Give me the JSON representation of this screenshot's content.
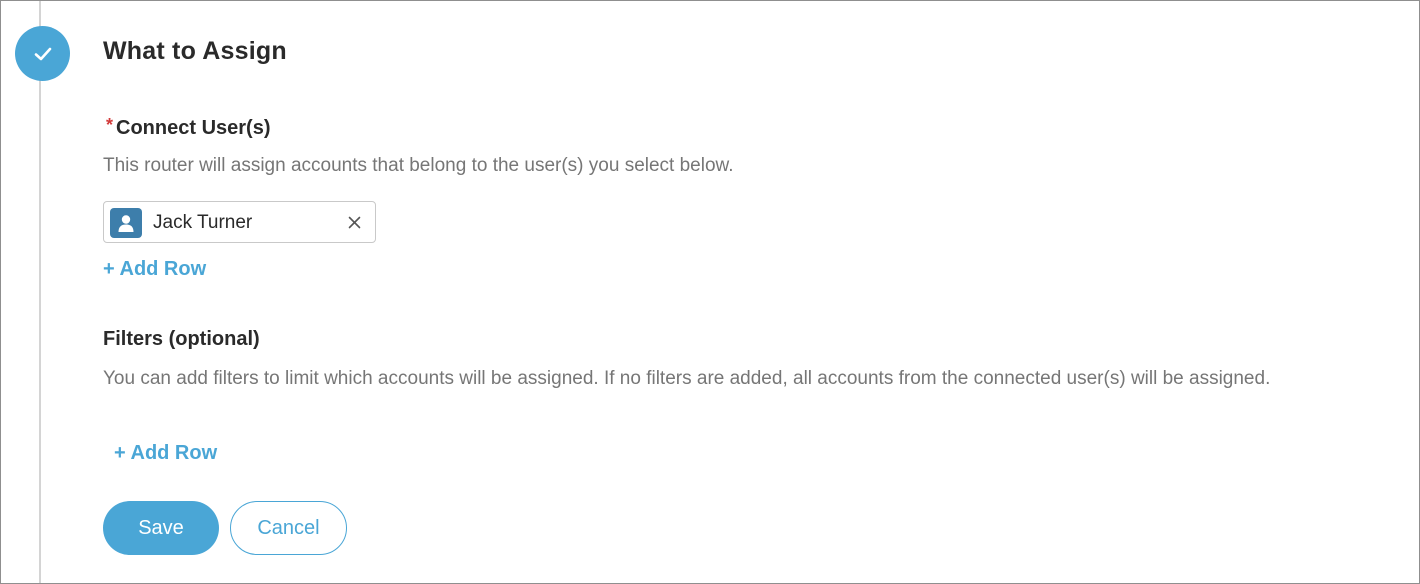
{
  "step": {
    "title": "What to Assign",
    "status_icon": "check-icon",
    "accent_color": "#4aa6d6"
  },
  "connect_users": {
    "required_marker": "*",
    "label": "Connect User(s)",
    "help": "This router will assign accounts that belong to the user(s) you select below.",
    "selected_users": [
      {
        "name": "Jack Turner",
        "icon": "user-icon"
      }
    ],
    "add_row_label": "+ Add Row"
  },
  "filters": {
    "label": "Filters (optional)",
    "help": "You can add filters to limit which accounts will be assigned. If no filters are added, all accounts from the connected user(s) will be assigned.",
    "add_row_label": "+ Add Row"
  },
  "actions": {
    "save_label": "Save",
    "cancel_label": "Cancel"
  }
}
